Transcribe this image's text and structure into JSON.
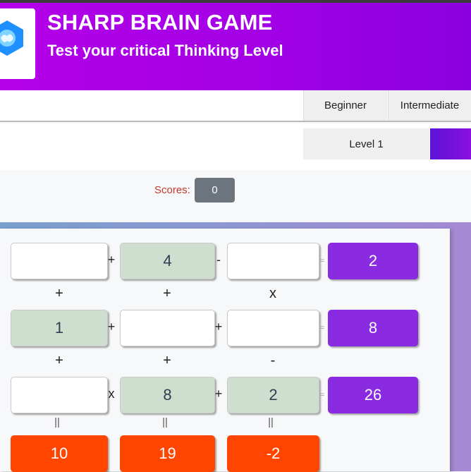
{
  "header": {
    "title": "SHARP BRAIN GAME",
    "subtitle": "Test your critical Thinking Level",
    "logo_icon": "brain-hexagon-icon",
    "accent": "#a300e6"
  },
  "tabs": [
    {
      "label": "Beginner"
    },
    {
      "label": "Intermediate"
    }
  ],
  "level": {
    "label": "Level 1"
  },
  "score": {
    "label": "Scores:",
    "value": "0"
  },
  "puzzle": {
    "rows": [
      {
        "cells": [
          "",
          "4",
          ""
        ],
        "ops": [
          "+",
          "-"
        ],
        "eq": "=",
        "result": "2"
      },
      {
        "cells": [
          "1",
          "",
          ""
        ],
        "ops": [
          "+",
          "+"
        ],
        "eq": "=",
        "result": "8"
      },
      {
        "cells": [
          "",
          "8",
          "2"
        ],
        "ops": [
          "x",
          "+"
        ],
        "eq": "=",
        "result": "26"
      }
    ],
    "vertical_ops": [
      [
        "+",
        "+",
        "x"
      ],
      [
        "+",
        "+",
        "-"
      ]
    ],
    "column_eq": [
      "||",
      "||",
      "||"
    ],
    "column_totals": [
      "10",
      "19",
      "-2"
    ]
  }
}
